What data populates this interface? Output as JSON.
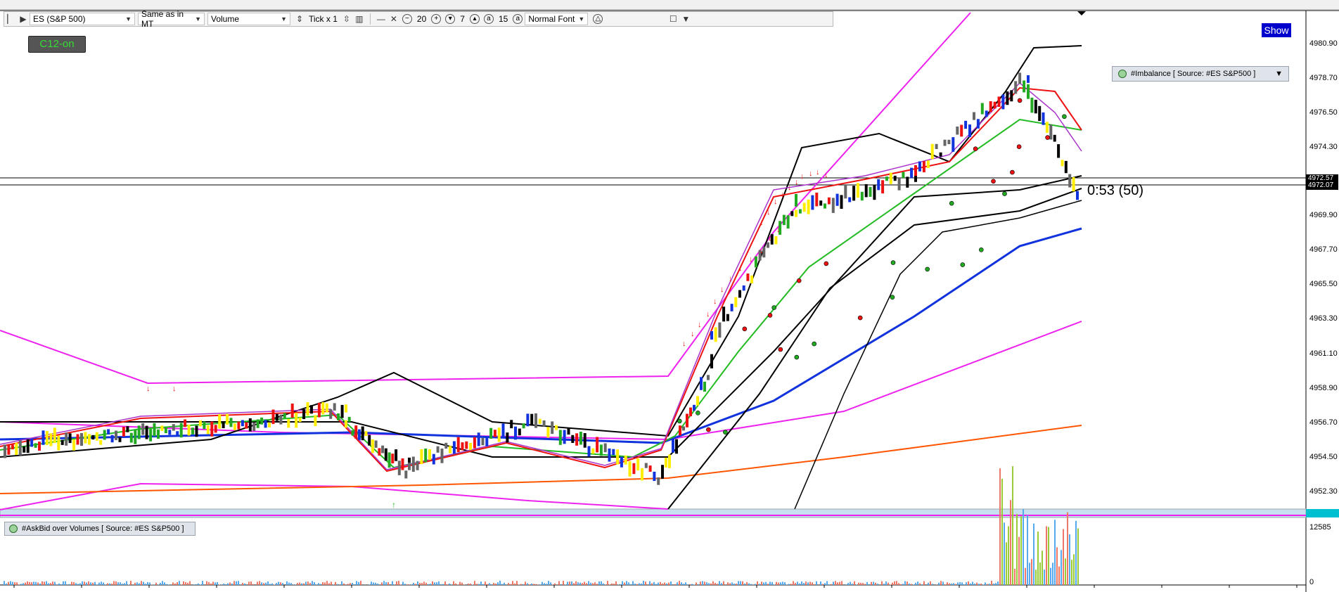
{
  "toolbar": {
    "symbol": "ES (S&P 500)",
    "timezone": "Same as in MT",
    "indicator": "Volume",
    "tick_label": "Tick x 1",
    "zoom_out_value": "20",
    "zoom_value_2": "7",
    "zoom_value_3": "15",
    "font_label": "Normal Font"
  },
  "badge": {
    "label": "C12-on",
    "color": "#33dd33"
  },
  "show_button": {
    "label": "Show"
  },
  "imbalance_legend": {
    "label": "#Imbalance [ Source: #ES S&P500 ]"
  },
  "askbid_legend": {
    "label": "#AskBid over Volumes [ Source: #ES S&P500 ]"
  },
  "timer": {
    "text": "0:53 (50)"
  },
  "price_axis": {
    "labels": [
      "4980.90",
      "4978.70",
      "4976.50",
      "4974.30",
      "4969.90",
      "4967.70",
      "4965.50",
      "4963.30",
      "4961.10",
      "4958.90",
      "4956.70",
      "4954.50",
      "4952.30"
    ],
    "current_price_1": "4972.57",
    "current_price_2": "4972.07"
  },
  "volume_axis": {
    "top": "12585",
    "bottom": "0"
  },
  "colors": {
    "accent": "#0000cc",
    "ma_red": "#ee1111",
    "ma_green": "#22bb22",
    "ma_blue": "#1133dd",
    "band_magenta": "#ee22ee",
    "orange": "#ff5500"
  }
}
